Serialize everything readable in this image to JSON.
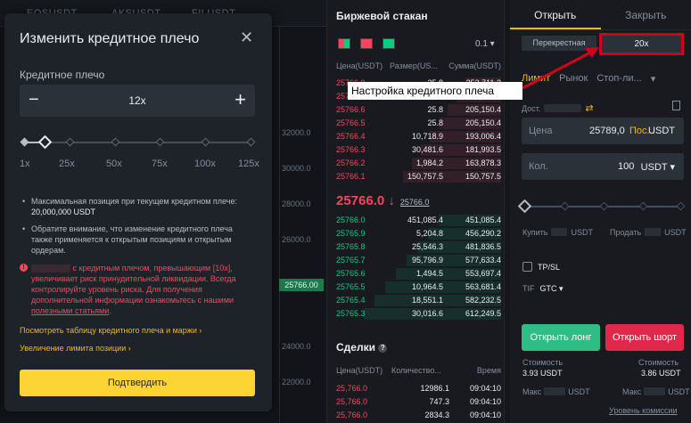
{
  "topstrip": {
    "items": [
      "EOSUSDT",
      "AKSUSDT",
      "FILUSDT"
    ]
  },
  "chart": {
    "price_levels": [
      "32000.0",
      "30000.0",
      "28000.0",
      "26000.0",
      "24000.0",
      "22000.0"
    ],
    "current_price": "25766.00"
  },
  "orderbook": {
    "title": "Биржевой стакан",
    "step": "0.1 ▾",
    "columns": [
      "Цена(USDT)",
      "Размер(US...",
      "Сумма(USDT)"
    ],
    "asks": [
      {
        "price": "25766.9",
        "size": "25.8",
        "sum": "253,711.2"
      },
      {
        "price": "25766.7",
        "size": "25.8",
        "sum": "253,711.2"
      },
      {
        "price": "25766.6",
        "size": "25.8",
        "sum": "205,150.4"
      },
      {
        "price": "25766.5",
        "size": "25.8",
        "sum": "205,150.4"
      },
      {
        "price": "25766.4",
        "size": "10,718.9",
        "sum": "193,006.4"
      },
      {
        "price": "25766.3",
        "size": "30,481.6",
        "sum": "181,993.5"
      },
      {
        "price": "25766.2",
        "size": "1,984.2",
        "sum": "163,878.3"
      },
      {
        "price": "25766.1",
        "size": "150,757.5",
        "sum": "150,757.5"
      }
    ],
    "mid_price": "25766.0",
    "mid_arrow": "↓",
    "mid_mark": "25766.0",
    "bids": [
      {
        "price": "25766.0",
        "size": "451,085.4",
        "sum": "451,085.4"
      },
      {
        "price": "25765.9",
        "size": "5,204.8",
        "sum": "456,290.2"
      },
      {
        "price": "25765.8",
        "size": "25,546.3",
        "sum": "481,836.5"
      },
      {
        "price": "25765.7",
        "size": "95,796.9",
        "sum": "577,633.4"
      },
      {
        "price": "25765.6",
        "size": "1,494.5",
        "sum": "553,697.4"
      },
      {
        "price": "25765.5",
        "size": "10,964.5",
        "sum": "563,681.4"
      },
      {
        "price": "25765.4",
        "size": "18,551.1",
        "sum": "582,232.5"
      },
      {
        "price": "25765.3",
        "size": "30,016.6",
        "sum": "612,249.5"
      }
    ]
  },
  "trades": {
    "title": "Сделки",
    "columns": [
      "Цена(USDT)",
      "Количество...",
      "Время"
    ],
    "rows": [
      {
        "price": "25,766.0",
        "qty": "12986.1",
        "time": "09:04:10"
      },
      {
        "price": "25,766.0",
        "qty": "747.3",
        "time": "09:04:10"
      },
      {
        "price": "25,766.0",
        "qty": "2834.3",
        "time": "09:04:10"
      }
    ]
  },
  "order_panel": {
    "tabs": [
      "Открыть",
      "Закрыть"
    ],
    "margin_mode": "Перекрестная",
    "leverage": "20x",
    "order_types": [
      "Лимит",
      "Рынок",
      "Стоп-ли..."
    ],
    "available_label": "Дост.",
    "price_field": {
      "label": "Цена",
      "value": "25789,0",
      "accent": "Пос...",
      "unit": "USDT"
    },
    "qty_field": {
      "label": "Кол.",
      "value": "100",
      "unit": "USDT ▾"
    },
    "buy_label": "Купить",
    "buy_unit": "USDT",
    "sell_label": "Продать",
    "sell_unit": "USDT",
    "tpsl": "TP/SL",
    "tif_label": "TIF",
    "tif_value": "GTC ▾",
    "open_long": "Открыть лонг",
    "open_short": "Открыть шорт",
    "cost_label": "Стоимость",
    "cost_long": "3.93 USDT",
    "cost_short": "3.86 USDT",
    "max_label": "Макс",
    "max_unit": "USDT",
    "fees": "Уровень комиссии"
  },
  "annotation": {
    "callout": "Настройка кредитного плеча"
  },
  "modal": {
    "title": "Изменить кредитное плечо",
    "close": "✕",
    "leverage_label": "Кредитное плечо",
    "minus": "−",
    "value": "12x",
    "plus": "+",
    "leverage_value": 12,
    "ticks": [
      "1x",
      "25x",
      "50x",
      "75x",
      "100x",
      "125x"
    ],
    "max_position_text": "Максимальная позиция при текущем кредитном плече:",
    "max_position_value": "20,000,000 USDT",
    "note": "Обратите внимание, что изменение кредитного плеча также применяется к открытым позициям и открытым ордерам.",
    "warning_a": "с кредитным плечом, превышающим [10x], увеличивает риск принудительной ликвидации. Всегда контролируйте уровень риска. Для получения дополнительной информации ознакомьтесь с нашими ",
    "warning_link": "полезными статьями",
    "warning_end": ".",
    "link_table": "Посмотреть таблицу кредитного плеча и маржи ›",
    "link_limit": "Увеличение лимита позиции ›",
    "confirm": "Подтвердить"
  },
  "colors": {
    "accent": "#f0b90b",
    "ask": "#f6465d",
    "bid": "#0ecb81",
    "highlight": "#d0021b"
  }
}
